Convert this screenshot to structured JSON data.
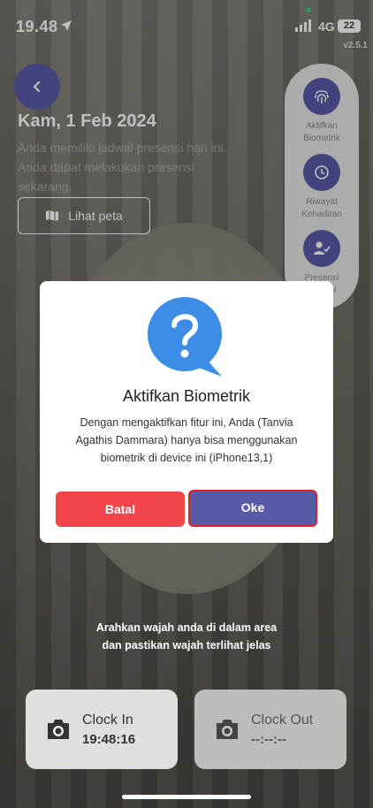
{
  "status_bar": {
    "time": "19.48",
    "network": "4G",
    "battery": "22",
    "version": "v2.5.1"
  },
  "header": {
    "date": "Kam, 1 Feb 2024",
    "schedule_line1": "Anda memiliki jadwal presensi hari ini.",
    "schedule_line2": "Anda dapat melakukan presensi",
    "schedule_line3": "sekarang.",
    "map_button": "Lihat peta"
  },
  "side_menu": {
    "biometric": "Aktifkan Biometrik",
    "history": "Riwayat Kehadiran",
    "presence": "Presensi Manual"
  },
  "dialog": {
    "title": "Aktifkan Biometrik",
    "message": "Dengan mengaktifkan fitur ini, Anda (Tanvia Agathis Dammara) hanya bisa menggunakan biometrik di device ini (iPhone13,1)",
    "cancel": "Batal",
    "ok": "Oke"
  },
  "instruction": {
    "line1": "Arahkan wajah anda di dalam area",
    "line2": "dan pastikan wajah terlihat jelas"
  },
  "clock": {
    "in_label": "Clock In",
    "in_time": "19:48:16",
    "out_label": "Clock Out",
    "out_time": "--:--:--"
  },
  "colors": {
    "primary": "#5a5ba8",
    "danger": "#f2444b",
    "icon_blue": "#3d8de6"
  }
}
